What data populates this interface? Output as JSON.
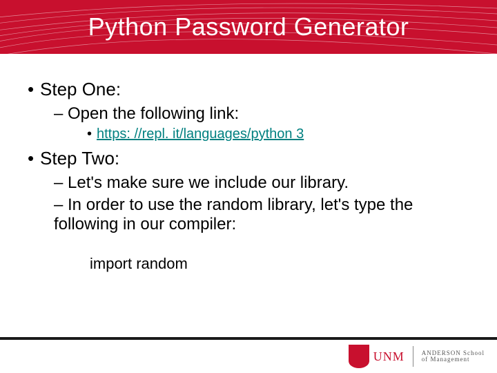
{
  "title": "Python Password Generator",
  "bullets": {
    "step1": "Step One:",
    "step1_sub": "– Open the following link:",
    "step1_link": "https: //repl. it/languages/python 3",
    "step2": "Step Two:",
    "step2_sub1": "– Let's make sure we include our library.",
    "step2_sub2": "– In order to use the random library, let's type the following in our compiler:",
    "code": "import random"
  },
  "logo": {
    "unm": "UNM",
    "school_line1": "ANDERSON School",
    "school_line2": "of Management"
  },
  "colors": {
    "brand": "#c8102e",
    "link": "#008080"
  }
}
